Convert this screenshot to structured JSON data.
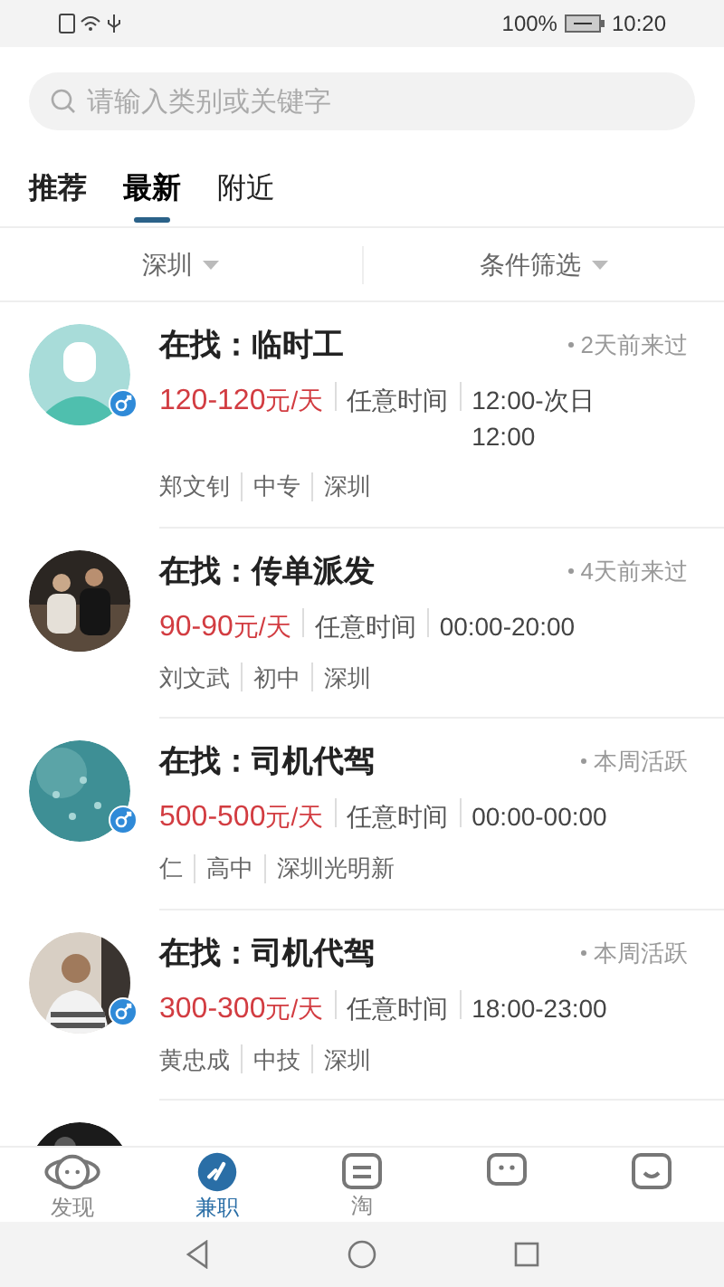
{
  "status_bar": {
    "battery": "100%",
    "time": "10:20"
  },
  "search": {
    "placeholder": "请输入类别或关键字"
  },
  "tabs": [
    {
      "label": "推荐",
      "selected": false
    },
    {
      "label": "最新",
      "selected": true
    },
    {
      "label": "附近",
      "selected": false
    }
  ],
  "filters": [
    "深圳",
    "条件筛选"
  ],
  "posts": [
    {
      "avatar": {
        "kind": "icon"
      },
      "male": true,
      "title": "在找：临时工",
      "active": "2天前来过",
      "price": "120-120",
      "unit": "元/天",
      "schedule": "任意时间",
      "hours": "12:00-次日12:00",
      "name": "郑文钊",
      "education": "中专",
      "city": "深圳"
    },
    {
      "avatar": {
        "kind": "picture"
      },
      "male": false,
      "title": "在找：传单派发",
      "active": "4天前来过",
      "price": "90-90",
      "unit": "元/天",
      "schedule": "任意时间",
      "hours": "00:00-20:00",
      "name": "刘文武",
      "education": "初中",
      "city": "深圳"
    },
    {
      "avatar": {
        "kind": "picture"
      },
      "male": true,
      "title": "在找：司机代驾",
      "active": "本周活跃",
      "price": "500-500",
      "unit": "元/天",
      "schedule": "任意时间",
      "hours": "00:00-00:00",
      "name": "仁",
      "education": "高中",
      "city": "深圳光明新"
    },
    {
      "avatar": {
        "kind": "picture"
      },
      "male": true,
      "title": "在找：司机代驾",
      "active": "本周活跃",
      "price": "300-300",
      "unit": "元/天",
      "schedule": "任意时间",
      "hours": "18:00-23:00",
      "name": "黄忠成",
      "education": "中技",
      "city": "深圳"
    },
    {
      "avatar": {
        "kind": "picture"
      }
    }
  ],
  "nav": [
    {
      "kind": "discover",
      "label": "发现",
      "selected": false
    },
    {
      "kind": "parttime",
      "label": "兼职",
      "selected": true
    },
    {
      "kind": "resume",
      "label": "淘",
      "selected": false
    },
    {
      "kind": "message",
      "selected": false
    },
    {
      "kind": "profile",
      "selected": false
    }
  ]
}
